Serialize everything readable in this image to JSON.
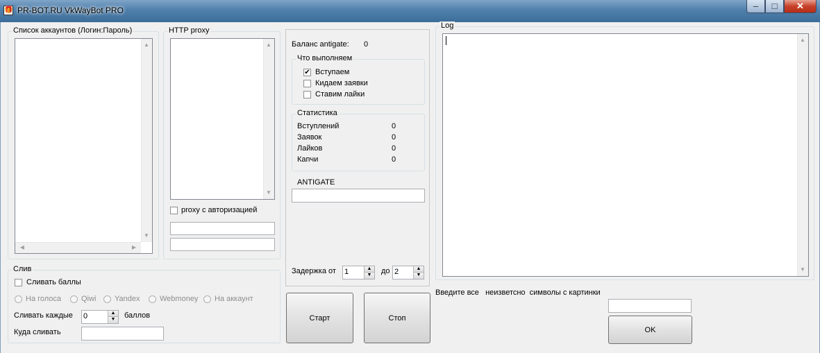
{
  "window": {
    "title": "PR-BOT.RU VkWayBot PRO",
    "icon": "gift-icon",
    "min": "–",
    "max": "□",
    "close": "✕"
  },
  "accounts": {
    "legend": "Список аккаунтов (Логин:Пароль)"
  },
  "proxy": {
    "legend": "HTTP proxy",
    "auth_label": "proxy с авторизацией",
    "login_value": "",
    "password_value": ""
  },
  "middle": {
    "balance_label": "Баланс antigate:",
    "balance_value": "0",
    "actions": {
      "legend": "Что выполняем",
      "items": [
        {
          "label": "Вступаем",
          "checked": true
        },
        {
          "label": "Кидаем заявки",
          "checked": false
        },
        {
          "label": "Ставим лайки",
          "checked": false
        }
      ]
    },
    "stats": {
      "legend": "Статистика",
      "rows": [
        {
          "label": "Вступлений",
          "value": "0"
        },
        {
          "label": "Заявок",
          "value": "0"
        },
        {
          "label": "Лайков",
          "value": "0"
        },
        {
          "label": "Капчи",
          "value": "0"
        }
      ]
    },
    "antigate": {
      "label": "ANTIGATE",
      "value": ""
    },
    "delay": {
      "from_label": "Задержка от",
      "from_value": "1",
      "to_label": "до",
      "to_value": "2"
    }
  },
  "sliv": {
    "legend": "Слив",
    "checkbox_label": "Сливать баллы",
    "options": [
      "На голоса",
      "Qiwi",
      "Yandex",
      "Webmoney",
      "На аккаунт"
    ],
    "every_label": "Сливать каждые",
    "every_value": "0",
    "points_label": "баллов",
    "where_label": "Куда сливать",
    "where_value": ""
  },
  "buttons": {
    "start": "Старт",
    "stop": "Стоп",
    "ok": "OK"
  },
  "log": {
    "legend": "Log",
    "text": ""
  },
  "captcha": {
    "prompt": "Введите все   неизветсно  символы с картинки",
    "value": ""
  }
}
